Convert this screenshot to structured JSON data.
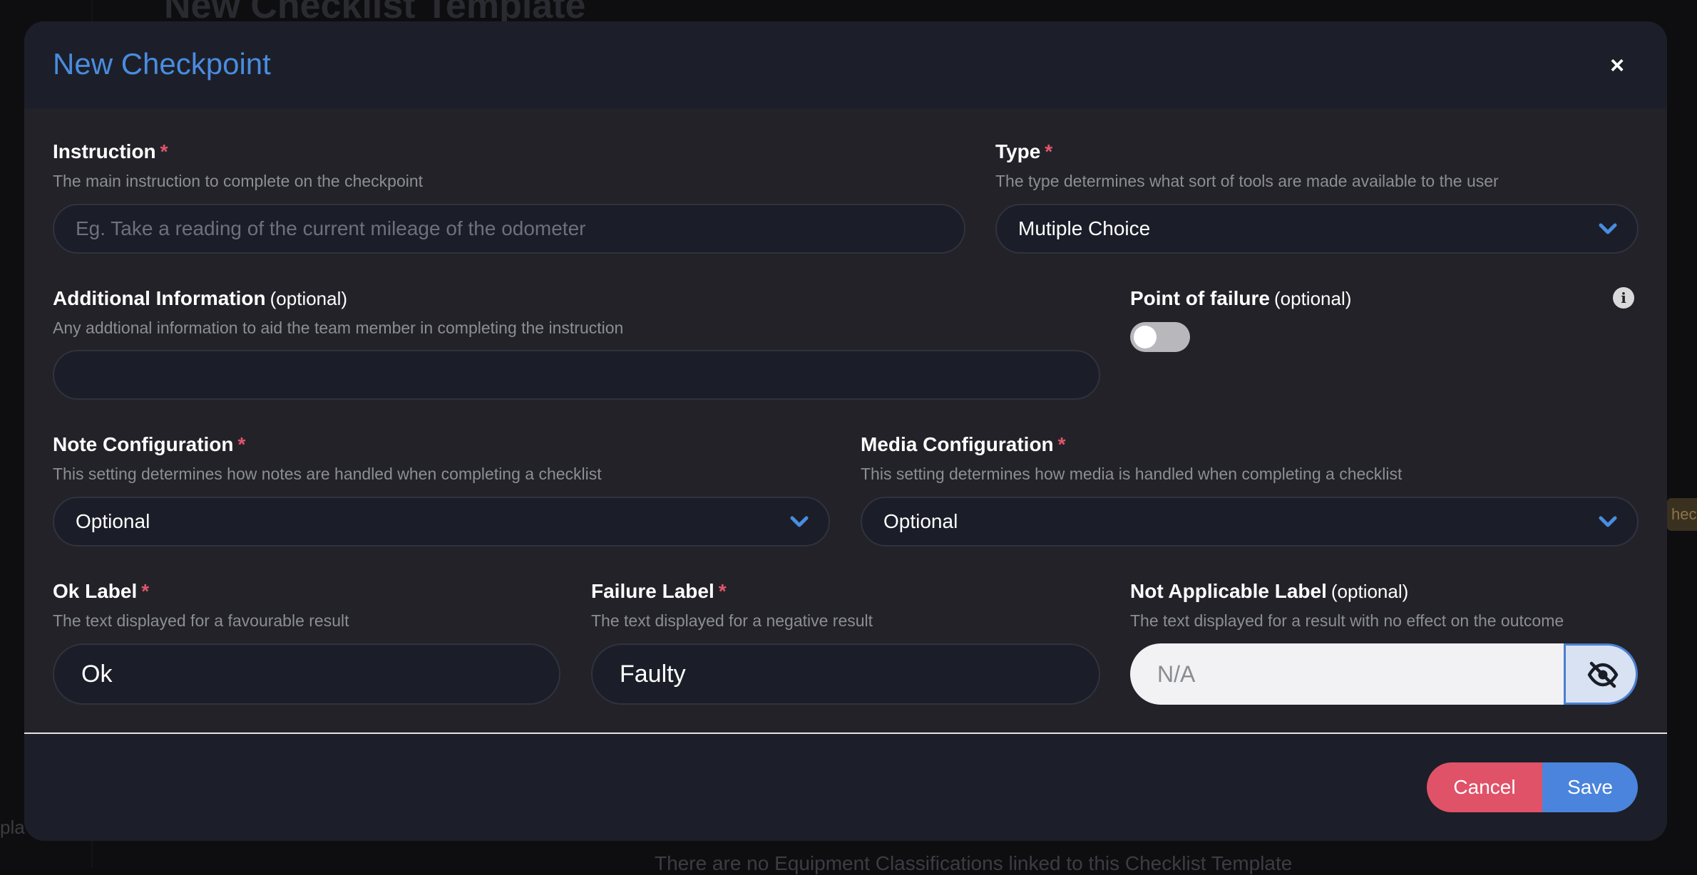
{
  "background": {
    "page_title": "New Checklist Template",
    "left_fragment": "pla",
    "right_fragment": "heck",
    "bottom_text": "There are no Equipment Classifications linked to this Checklist Template"
  },
  "modal": {
    "title": "New Checkpoint",
    "close_label": "×"
  },
  "fields": {
    "instruction": {
      "label": "Instruction",
      "required_mark": "*",
      "help": "The main instruction to complete on the checkpoint",
      "placeholder": "Eg. Take a reading of the current mileage of the odometer",
      "value": ""
    },
    "type": {
      "label": "Type",
      "required_mark": "*",
      "help": "The type determines what sort of tools are made available to the user",
      "value": "Mutiple Choice"
    },
    "additional_information": {
      "label": "Additional Information",
      "optional_mark": "(optional)",
      "help": "Any addtional information to aid the team member in completing the instruction",
      "value": ""
    },
    "point_of_failure": {
      "label": "Point of failure",
      "optional_mark": "(optional)",
      "enabled": false
    },
    "note_configuration": {
      "label": "Note Configuration",
      "required_mark": "*",
      "help": "This setting determines how notes are handled when completing a checklist",
      "value": "Optional"
    },
    "media_configuration": {
      "label": "Media Configuration",
      "required_mark": "*",
      "help": "This setting determines how media is handled when completing a checklist",
      "value": "Optional"
    },
    "ok_label": {
      "label": "Ok Label",
      "required_mark": "*",
      "help": "The text displayed for a favourable result",
      "value": "Ok"
    },
    "failure_label": {
      "label": "Failure Label",
      "required_mark": "*",
      "help": "The text displayed for a negative result",
      "value": "Faulty"
    },
    "not_applicable_label": {
      "label": "Not Applicable Label",
      "optional_mark": "(optional)",
      "help": "The text displayed for a result with no effect on the outcome",
      "placeholder": "N/A",
      "hidden": true
    }
  },
  "footer": {
    "cancel_label": "Cancel",
    "save_label": "Save"
  },
  "icons": {
    "close": "close-icon",
    "chevron": "chevron-down-icon",
    "info": "info-icon",
    "visibility": "eye-slash-icon"
  },
  "colors": {
    "accent": "#4a8cdf",
    "required": "#e0566a",
    "cancel": "#e05268",
    "save": "#4a84dc"
  }
}
